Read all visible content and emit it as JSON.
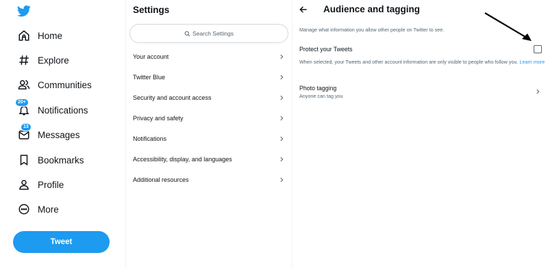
{
  "nav": {
    "items": [
      {
        "label": "Home",
        "icon": "home-icon"
      },
      {
        "label": "Explore",
        "icon": "hashtag-icon"
      },
      {
        "label": "Communities",
        "icon": "communities-icon"
      },
      {
        "label": "Notifications",
        "icon": "bell-icon",
        "badge": "20+"
      },
      {
        "label": "Messages",
        "icon": "envelope-icon",
        "badge": "13"
      },
      {
        "label": "Bookmarks",
        "icon": "bookmark-icon"
      },
      {
        "label": "Profile",
        "icon": "profile-icon"
      },
      {
        "label": "More",
        "icon": "more-circle-icon"
      }
    ],
    "tweet_label": "Tweet"
  },
  "settings": {
    "title": "Settings",
    "search_placeholder": "Search Settings",
    "items": [
      "Your account",
      "Twitter Blue",
      "Security and account access",
      "Privacy and safety",
      "Notifications",
      "Accessibility, display, and languages",
      "Additional resources"
    ]
  },
  "audience": {
    "title": "Audience and tagging",
    "description": "Manage what information you allow other people on Twitter to see.",
    "protect_label": "Protect your Tweets",
    "protect_help": "When selected, your Tweets and other account information are only visible to people who follow you.",
    "learn_more": "Learn more",
    "protect_checked": false,
    "photo_tagging_label": "Photo tagging",
    "photo_tagging_sub": "Anyone can tag you"
  },
  "colors": {
    "accent": "#1d9bf0",
    "text": "#0f1419",
    "muted": "#536471"
  }
}
